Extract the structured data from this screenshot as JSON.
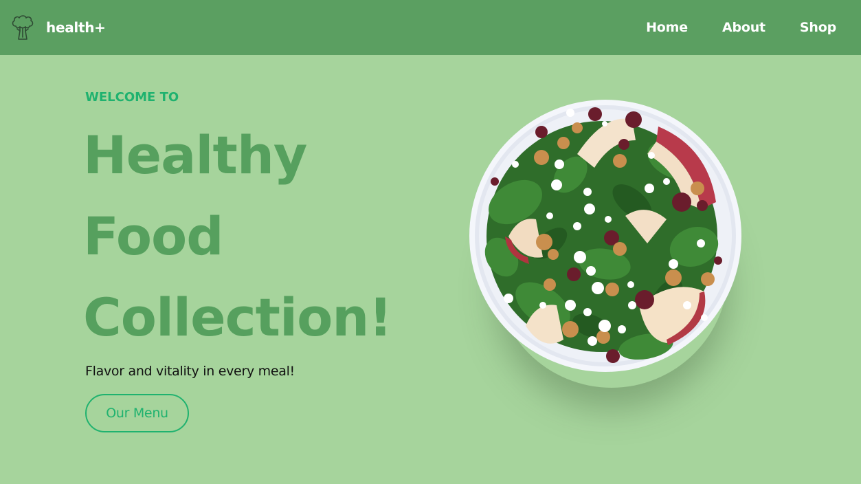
{
  "nav": {
    "brand": "health+",
    "logo_icon": "broccoli-icon",
    "links": [
      {
        "label": "Home"
      },
      {
        "label": "About"
      },
      {
        "label": "Shop"
      }
    ]
  },
  "hero": {
    "eyebrow": "WELCOME TO",
    "title_lines": [
      "Healthy",
      "Food",
      "Collection!"
    ],
    "tagline": "Flavor and vitality in every meal!",
    "cta_label": "Our Menu",
    "image_icon": "salad-bowl-image"
  },
  "colors": {
    "background": "#a6d49c",
    "navbar": "#5b9f61",
    "title": "#56a05e",
    "accent": "#1fb26f",
    "text": "#111111"
  }
}
